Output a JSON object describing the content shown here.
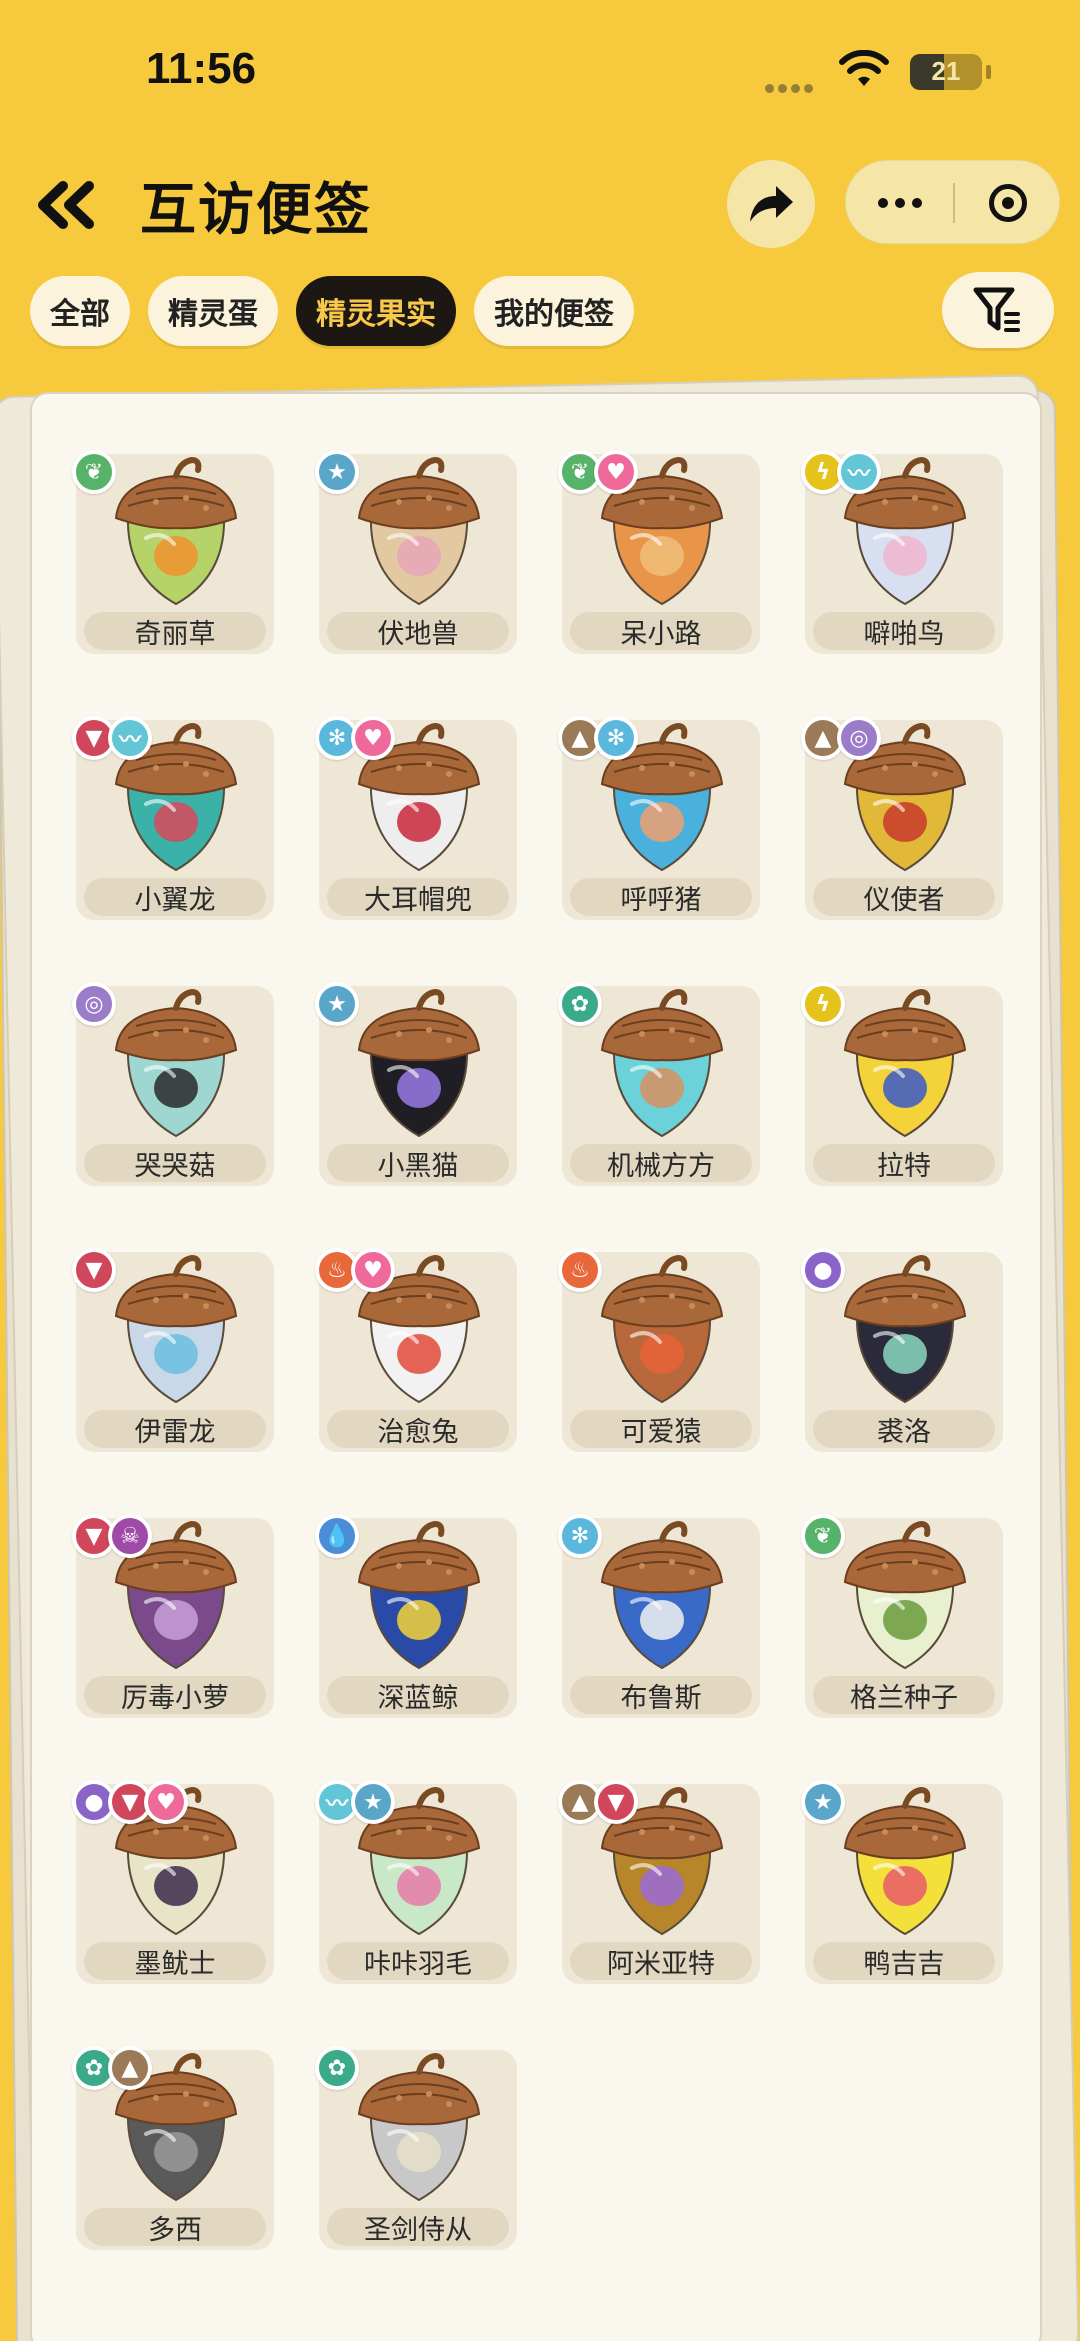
{
  "status_bar": {
    "time": "11:56",
    "battery": "21"
  },
  "header": {
    "title": "互访便签"
  },
  "tabs": [
    {
      "label": "全部",
      "active": false
    },
    {
      "label": "精灵蛋",
      "active": false
    },
    {
      "label": "精灵果实",
      "active": true
    },
    {
      "label": "我的便签",
      "active": false
    }
  ],
  "colors": {
    "background": "#f7c93c",
    "active_tab": "#1c1712",
    "active_tab_text": "#f8c84a",
    "type": {
      "grass": "#57b36a",
      "normal": "#5aa6c9",
      "fairy": "#ef6a9a",
      "electric": "#e5c31a",
      "wing": "#62c6d6",
      "dragon": "#d0465a",
      "ice": "#5ab8dc",
      "ground": "#9b7b57",
      "illusion": "#9b7cc8",
      "machine": "#3aaa88",
      "fire": "#e9683a",
      "ghost": "#8b64c8",
      "poison": "#a04aa8",
      "water": "#4a8ed8"
    }
  },
  "fruits": [
    {
      "name": "奇丽草",
      "types": [
        "grass"
      ],
      "palette": [
        "#b6d36a",
        "#f0922e"
      ]
    },
    {
      "name": "伏地兽",
      "types": [
        "normal"
      ],
      "palette": [
        "#e2c9a2",
        "#e8a6b8"
      ]
    },
    {
      "name": "呆小路",
      "types": [
        "grass",
        "fairy"
      ],
      "palette": [
        "#e8954a",
        "#f0c07a"
      ]
    },
    {
      "name": "噼啪鸟",
      "types": [
        "electric",
        "wing"
      ],
      "palette": [
        "#d8dff0",
        "#f0b6d0"
      ]
    },
    {
      "name": "小翼龙",
      "types": [
        "dragon",
        "wing"
      ],
      "palette": [
        "#3ab2a8",
        "#d8485a"
      ]
    },
    {
      "name": "大耳帽兜",
      "types": [
        "ice",
        "fairy"
      ],
      "palette": [
        "#eeeeee",
        "#c8283a"
      ]
    },
    {
      "name": "呼呼猪",
      "types": [
        "ground",
        "ice"
      ],
      "palette": [
        "#4ab0dc",
        "#f0a070"
      ]
    },
    {
      "name": "仪使者",
      "types": [
        "ground",
        "illusion"
      ],
      "palette": [
        "#e2b838",
        "#c83a2a"
      ]
    },
    {
      "name": "哭哭菇",
      "types": [
        "illusion"
      ],
      "palette": [
        "#9ed6d2",
        "#2a2a2a"
      ]
    },
    {
      "name": "小黑猫",
      "types": [
        "normal"
      ],
      "palette": [
        "#1e1e24",
        "#9a7ae6"
      ]
    },
    {
      "name": "机械方方",
      "types": [
        "machine"
      ],
      "palette": [
        "#6ad2d8",
        "#d89060"
      ]
    },
    {
      "name": "拉特",
      "types": [
        "electric"
      ],
      "palette": [
        "#f4d23a",
        "#3a5ac8"
      ]
    },
    {
      "name": "伊雷龙",
      "types": [
        "dragon"
      ],
      "palette": [
        "#c8d8e8",
        "#6ac0e0"
      ]
    },
    {
      "name": "治愈兔",
      "types": [
        "fire",
        "fairy"
      ],
      "palette": [
        "#f2f2f2",
        "#e04a3a"
      ]
    },
    {
      "name": "可爱猿",
      "types": [
        "fire"
      ],
      "palette": [
        "#b8683a",
        "#e8643a"
      ]
    },
    {
      "name": "裘洛",
      "types": [
        "ghost"
      ],
      "palette": [
        "#2a2a3a",
        "#8ad8c0"
      ]
    },
    {
      "name": "厉毒小萝",
      "types": [
        "dragon",
        "poison"
      ],
      "palette": [
        "#7a4a8a",
        "#c8a0d8"
      ]
    },
    {
      "name": "深蓝鲸",
      "types": [
        "water"
      ],
      "palette": [
        "#2a4aa8",
        "#f4d23a"
      ]
    },
    {
      "name": "布鲁斯",
      "types": [
        "ice"
      ],
      "palette": [
        "#3a6ac8",
        "#f2f2f2"
      ]
    },
    {
      "name": "格兰种子",
      "types": [
        "grass"
      ],
      "palette": [
        "#e8f0d0",
        "#6a9a3a"
      ]
    },
    {
      "name": "墨鱿士",
      "types": [
        "ghost",
        "dragon",
        "fairy"
      ],
      "palette": [
        "#e8e4c8",
        "#3a2a4a"
      ]
    },
    {
      "name": "咔咔羽毛",
      "types": [
        "wing",
        "normal"
      ],
      "palette": [
        "#c8e8c8",
        "#e87aa8"
      ]
    },
    {
      "name": "阿米亚特",
      "types": [
        "ground",
        "dragon"
      ],
      "palette": [
        "#b8862a",
        "#9a6ad8"
      ]
    },
    {
      "name": "鸭吉吉",
      "types": [
        "normal"
      ],
      "palette": [
        "#f4e03a",
        "#e85a6a"
      ]
    },
    {
      "name": "多西",
      "types": [
        "machine",
        "ground"
      ],
      "palette": [
        "#5a5a5a",
        "#9a9a9a"
      ]
    },
    {
      "name": "圣剑侍从",
      "types": [
        "machine"
      ],
      "palette": [
        "#c8c8c8",
        "#e8e0c8"
      ]
    }
  ]
}
